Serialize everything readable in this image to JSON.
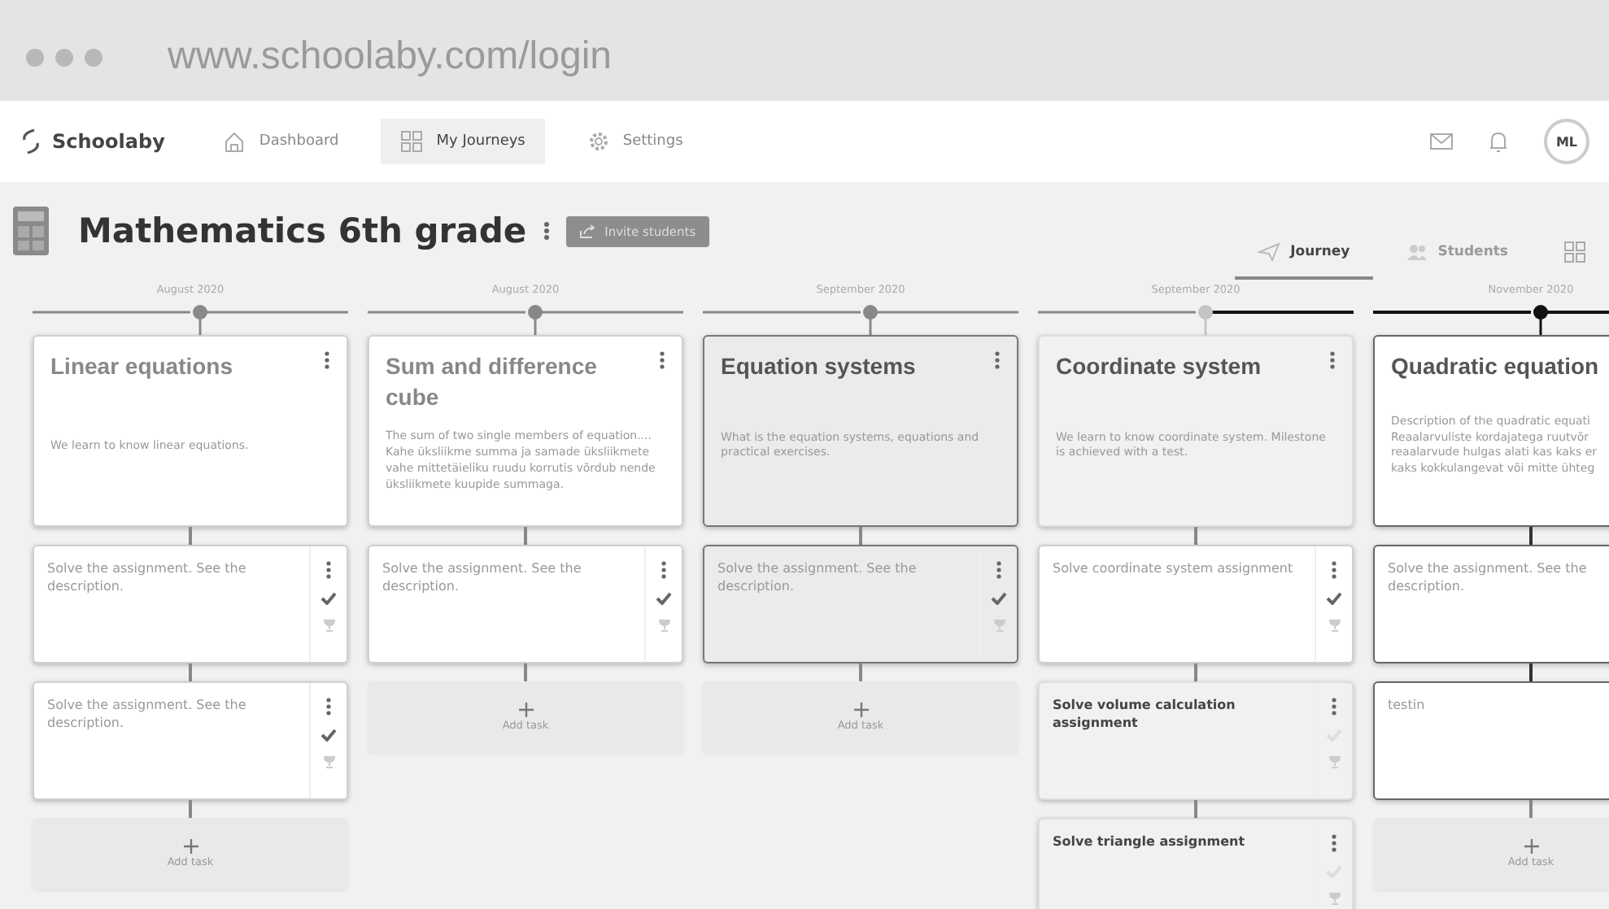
{
  "browser": {
    "url": "www.schoolaby.com/login"
  },
  "nav": {
    "brand": "Schoolaby",
    "items": [
      {
        "label": "Dashboard",
        "selected": false
      },
      {
        "label": "My Journeys",
        "selected": true
      },
      {
        "label": "Settings",
        "selected": false
      }
    ],
    "avatar": "ML"
  },
  "journey": {
    "title": "Mathematics 6th grade",
    "invite_button": "Invite students",
    "tabs": [
      {
        "label": "Journey",
        "selected": true
      },
      {
        "label": "Students",
        "selected": false
      }
    ]
  },
  "milestones": [
    {
      "date": "August 2020",
      "completed": true,
      "current": false,
      "title": "Linear equations",
      "selected": false,
      "kind": "standard",
      "description": "We learn to know linear equations.",
      "tasks": [
        {
          "text": "Solve the assignment. See the description.",
          "selected": false,
          "kind": "standard",
          "checked": true
        },
        {
          "text": "Solve the assignment. See the description.",
          "selected": false,
          "kind": "standard",
          "checked": true
        }
      ],
      "add_task": "Add task"
    },
    {
      "date": "August 2020",
      "completed": true,
      "current": false,
      "title": "Sum and difference cube",
      "selected": false,
      "kind": "standard",
      "description": "The sum of two single members of equation.... Kahe üksliikme summa ja samade üksliikmete vahe mittetäieliku ruudu korrutis võrdub nende üksliikmete kuupide summaga.",
      "tasks": [
        {
          "text": "Solve the assignment. See the description.",
          "selected": false,
          "kind": "standard",
          "checked": true
        }
      ],
      "add_task": "Add task"
    },
    {
      "date": "September 2020",
      "completed": true,
      "current": false,
      "title": "Equation systems",
      "selected": true,
      "kind": "standard",
      "description": "What is the equation systems, equations and practical exercises.",
      "tasks": [
        {
          "text": "Solve the assignment. See the description.",
          "selected": true,
          "kind": "standard",
          "checked": true
        }
      ],
      "add_task": "Add task"
    },
    {
      "date": "September 2020",
      "completed": false,
      "current": false,
      "title": "Coordinate system",
      "selected": false,
      "kind": "muted",
      "description": "We learn to know coordinate system. Milestone is achieved with a test.",
      "tasks": [
        {
          "text": "Solve coordinate system assignment",
          "selected": false,
          "kind": "standard",
          "checked": true
        },
        {
          "text": "Solve volume calculation assignment",
          "selected": false,
          "kind": "muted",
          "checked": false
        },
        {
          "text": "Solve triangle assignment",
          "selected": false,
          "kind": "muted",
          "checked": false
        }
      ]
    },
    {
      "date": "November 2020",
      "completed": false,
      "current": true,
      "title": "Quadratic equation",
      "selected": false,
      "kind": "highlighted",
      "description": [
        "Description of the quadratic equati",
        "Reaalarvuliste kordajatega ruutvõr",
        "reaalarvude hulgas alati kas kaks er",
        "kaks kokkulangevat või mitte ühteg"
      ],
      "tasks": [
        {
          "text": "Solve the assignment. See the description.",
          "selected": false,
          "kind": "highlighted"
        },
        {
          "text": "testin",
          "selected": false,
          "kind": "highlighted"
        }
      ],
      "add_task": "Add task"
    }
  ]
}
